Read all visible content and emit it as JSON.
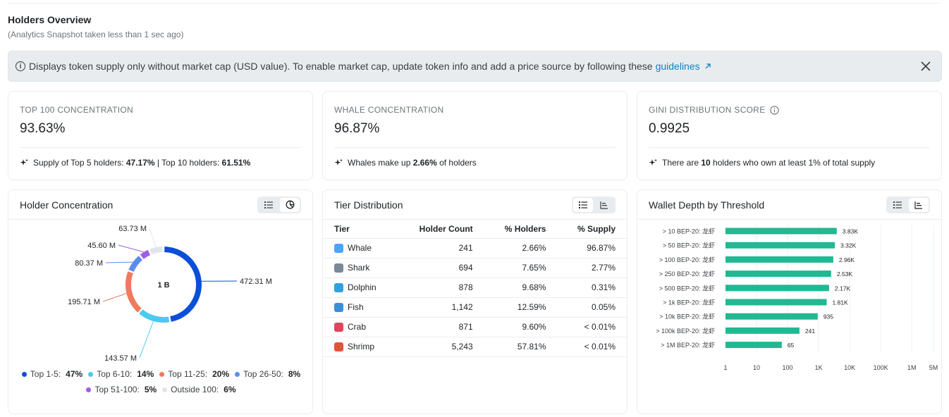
{
  "header": {
    "title": "Holders Overview",
    "subtitle": "(Analytics Snapshot taken less than 1 sec ago)"
  },
  "alert": {
    "text": "Displays token supply only without market cap (USD value). To enable market cap, update token info and add a price source by following these",
    "link": "guidelines",
    "link_icon": "external-arrow-icon",
    "close_icon": "close-icon"
  },
  "stats": [
    {
      "label": "TOP 100 CONCENTRATION",
      "value": "93.63%",
      "foot": [
        {
          "t": "Supply of Top 5 holders: ",
          "b": false
        },
        {
          "t": "47.17%",
          "b": true
        },
        {
          "t": " | Top 10 holders: ",
          "b": false
        },
        {
          "t": "61.51%",
          "b": true
        }
      ]
    },
    {
      "label": "WHALE CONCENTRATION",
      "value": "96.87%",
      "foot": [
        {
          "t": "Whales make up ",
          "b": false
        },
        {
          "t": "2.66%",
          "b": true
        },
        {
          "t": " of holders",
          "b": false
        }
      ]
    },
    {
      "label": "GINI DISTRIBUTION SCORE",
      "value": "0.9925",
      "has_info": true,
      "foot": [
        {
          "t": "There are ",
          "b": false
        },
        {
          "t": "10",
          "b": true
        },
        {
          "t": " holders who own at least 1% of total supply",
          "b": false
        }
      ]
    }
  ],
  "panels": {
    "concentration": {
      "title": "Holder Concentration",
      "center_label": "1 B"
    },
    "tier": {
      "title": "Tier Distribution",
      "columns": [
        "Tier",
        "Holder Count",
        "% Holders",
        "% Supply"
      ],
      "rows": [
        {
          "icon": "whale-icon",
          "color": "#4da3ff",
          "tier": "Whale",
          "count": "241",
          "holders": "2.66%",
          "supply": "96.87%"
        },
        {
          "icon": "shark-icon",
          "color": "#7a8a99",
          "tier": "Shark",
          "count": "694",
          "holders": "7.65%",
          "supply": "2.77%"
        },
        {
          "icon": "dolphin-icon",
          "color": "#2fa0e0",
          "tier": "Dolphin",
          "count": "878",
          "holders": "9.68%",
          "supply": "0.31%"
        },
        {
          "icon": "fish-icon",
          "color": "#3a8fd8",
          "tier": "Fish",
          "count": "1,142",
          "holders": "12.59%",
          "supply": "0.05%"
        },
        {
          "icon": "crab-icon",
          "color": "#e0455c",
          "tier": "Crab",
          "count": "871",
          "holders": "9.60%",
          "supply": "< 0.01%"
        },
        {
          "icon": "shrimp-icon",
          "color": "#e0553a",
          "tier": "Shrimp",
          "count": "5,243",
          "holders": "57.81%",
          "supply": "< 0.01%"
        }
      ]
    },
    "depth": {
      "title": "Wallet Depth by Threshold"
    }
  },
  "chart_data": [
    {
      "type": "pie",
      "center_label": "1 B",
      "slices": [
        {
          "name": "Top 1-5",
          "pct": "47%",
          "value": 472.31,
          "label": "472.31 M",
          "color": "#0b4fd8"
        },
        {
          "name": "Top 6-10",
          "pct": "14%",
          "value": 143.57,
          "label": "143.57 M",
          "color": "#4cc9f0"
        },
        {
          "name": "Top 11-25",
          "pct": "20%",
          "value": 195.71,
          "label": "195.71 M",
          "color": "#f07a5e"
        },
        {
          "name": "Top 26-50",
          "pct": "8%",
          "value": 80.37,
          "label": "80.37 M",
          "color": "#5b8def"
        },
        {
          "name": "Top 51-100",
          "pct": "5%",
          "value": 45.6,
          "label": "45.60 M",
          "color": "#9b5de5"
        },
        {
          "name": "Outside 100",
          "pct": "6%",
          "value": 63.73,
          "label": "63.73 M",
          "color": "#e1e4ea"
        }
      ]
    },
    {
      "type": "bar",
      "orientation": "horizontal",
      "scale": "log",
      "categories": [
        "> 10 BEP-20: 龙虾",
        "> 50 BEP-20: 龙虾",
        "> 100 BEP-20: 龙虾",
        "> 250 BEP-20: 龙虾",
        "> 500 BEP-20: 龙虾",
        "> 1k BEP-20: 龙虾",
        "> 10k BEP-20: 龙虾",
        "> 100k BEP-20: 龙虾",
        "> 1M BEP-20: 龙虾"
      ],
      "values": [
        3830,
        3320,
        2960,
        2530,
        2170,
        1810,
        935,
        241,
        65
      ],
      "value_labels": [
        "3.83K",
        "3.32K",
        "2.96K",
        "2.53K",
        "2.17K",
        "1.81K",
        "935",
        "241",
        "65"
      ],
      "xticks": [
        "1",
        "10",
        "100",
        "1K",
        "10K",
        "100K",
        "1M",
        "5M"
      ],
      "xtick_values": [
        1,
        10,
        100,
        1000,
        10000,
        100000,
        1000000,
        5000000
      ],
      "color": "#21b892"
    }
  ]
}
